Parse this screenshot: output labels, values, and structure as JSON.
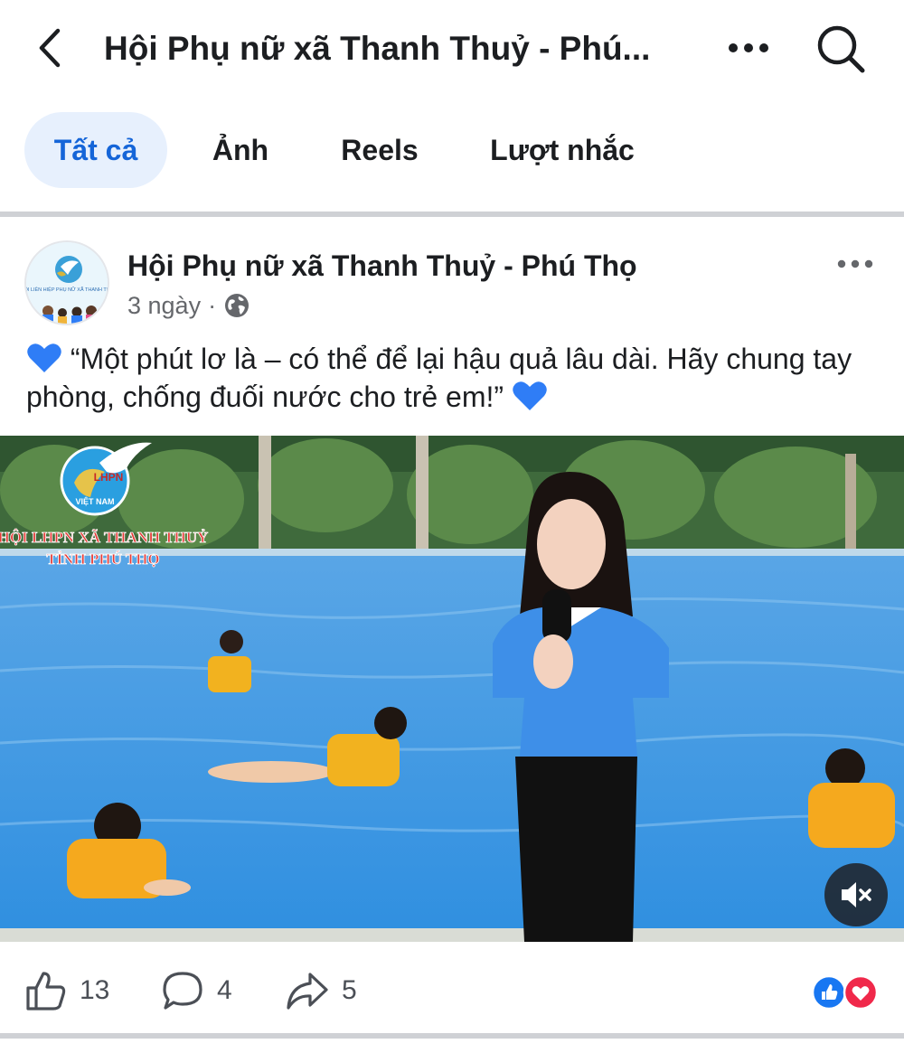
{
  "header": {
    "title": "Hội Phụ nữ xã Thanh Thuỷ - Phú..."
  },
  "tabs": [
    {
      "label": "Tất cả",
      "active": true
    },
    {
      "label": "Ảnh",
      "active": false
    },
    {
      "label": "Reels",
      "active": false
    },
    {
      "label": "Lượt nhắc",
      "active": false
    }
  ],
  "post": {
    "author": "Hội Phụ nữ xã Thanh Thuỷ - Phú Thọ",
    "time": "3 ngày",
    "privacy_icon": "globe-icon",
    "text": "“Một phút lơ là – có thể để lại hậu quả lâu dài. Hãy chung tay phòng, chống đuối nước cho trẻ em!”",
    "avatar_logo_text": "HỘI LIÊN HIỆP PHỤ NỮ XÃ THANH THUỶ",
    "media": {
      "logo_text": "LHPN",
      "logo_country": "VIỆT NAM",
      "overlay_line1": "HỘI LHPN XÃ THANH THUỶ",
      "overlay_line2": "TỈNH PHÚ THỌ"
    },
    "likes": "13",
    "comments": "4",
    "shares": "5"
  },
  "colors": {
    "accent": "#1565d8",
    "active_tab_bg": "#e7f0fd",
    "heart_blue": "#2f7df6",
    "like_blue": "#1877f2",
    "love_red": "#f0284a"
  }
}
